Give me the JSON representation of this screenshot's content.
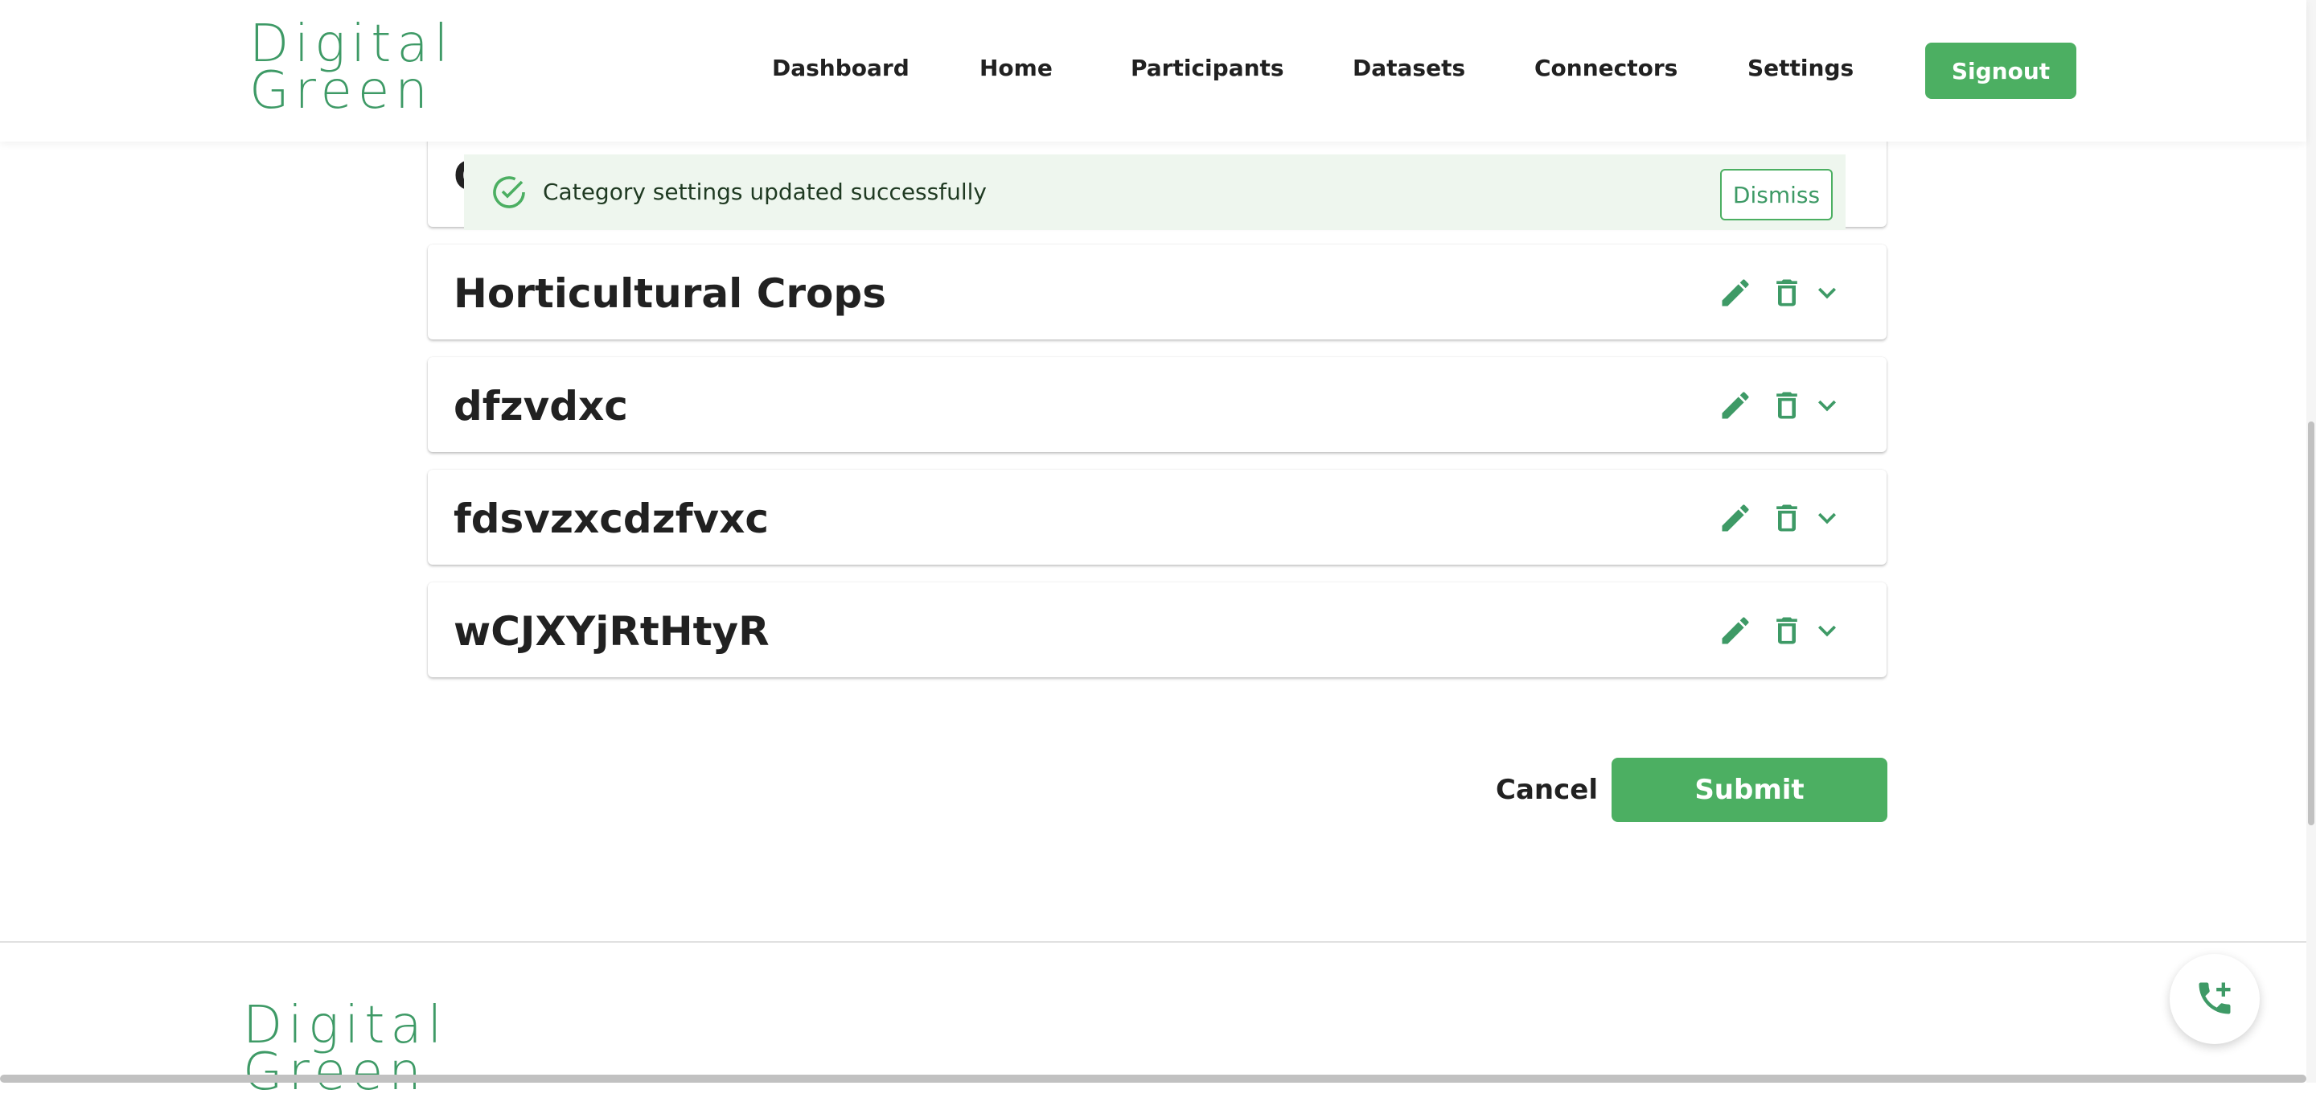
{
  "header": {
    "logo_line1": "Digital",
    "logo_line2": "Green",
    "nav": [
      "Dashboard",
      "Home",
      "Participants",
      "Datasets",
      "Connectors",
      "Settings"
    ],
    "signout_label": "Signout"
  },
  "toast": {
    "icon": "check-circle-icon",
    "message": "Category settings updated successfully",
    "dismiss_label": "Dismiss"
  },
  "categories": [
    {
      "title": "C"
    },
    {
      "title": "Horticultural Crops"
    },
    {
      "title": "dfzvdxc"
    },
    {
      "title": "fdsvzxcdzfvxc"
    },
    {
      "title": "wCJXYjRtHtyR"
    }
  ],
  "actions": {
    "cancel_label": "Cancel",
    "submit_label": "Submit"
  },
  "footer": {
    "logo_line1": "Digital",
    "logo_line2": "Green",
    "fab_icon": "phone-add-icon"
  },
  "colors": {
    "brand_green": "#4caf62",
    "logo_green": "#3e9a66",
    "toast_bg": "#eef6ee"
  }
}
